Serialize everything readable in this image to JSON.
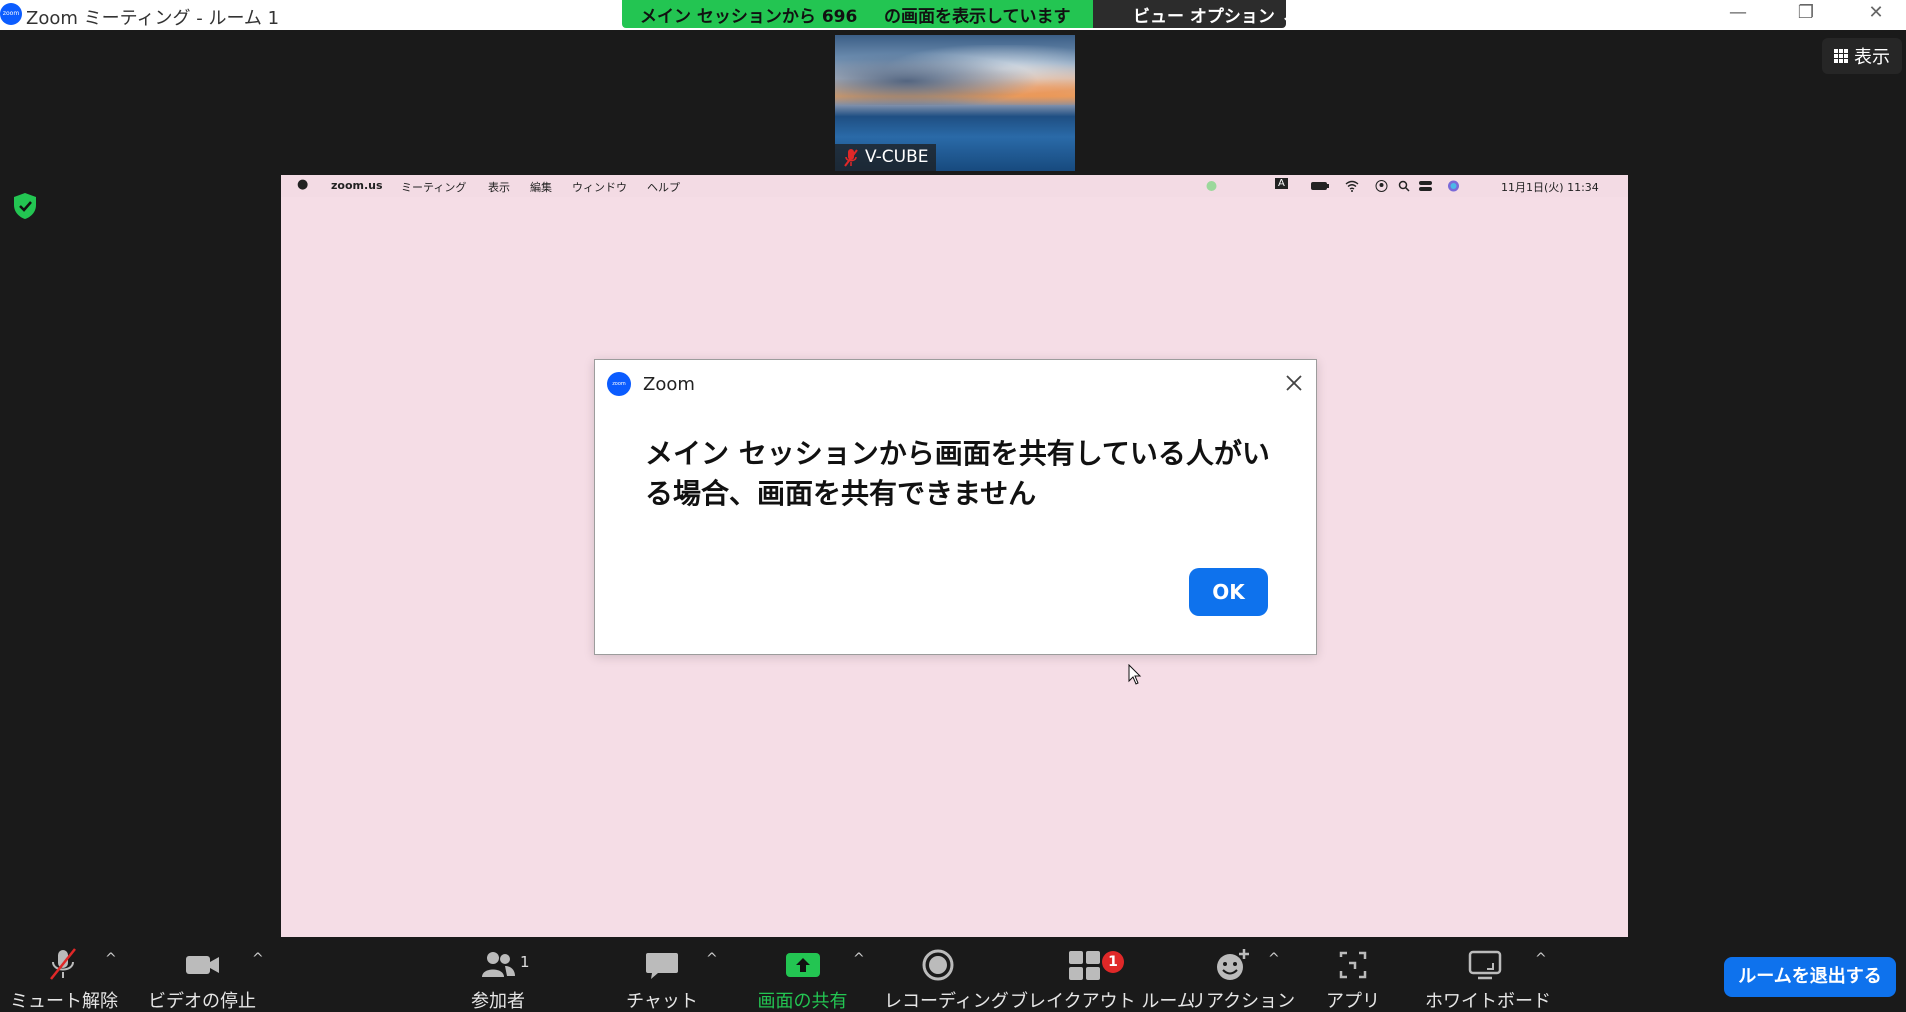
{
  "window": {
    "title": "Zoom ミーティング - ルーム 1",
    "app_logo_text": "zoom"
  },
  "banner": {
    "status_part1": "メイン セッションから 696",
    "status_part2": "の画面を表示しています",
    "view_options_label": "ビュー オプション ⌄"
  },
  "window_controls": {
    "minimize": "—",
    "restore": "❐",
    "close": "✕"
  },
  "view_button": {
    "label": "表示"
  },
  "participant": {
    "name": "V-CUBE"
  },
  "shared_screen": {
    "menubar": {
      "app": "zoom.us",
      "items": [
        "ミーティング",
        "表示",
        "編集",
        "ウィンドウ",
        "ヘルプ"
      ],
      "input_indicator": "A",
      "clock": "11月1日(火)  11:34"
    }
  },
  "dialog": {
    "title": "Zoom",
    "message": "メイン セッションから画面を共有している人がいる場合、画面を共有できません",
    "ok_label": "OK"
  },
  "toolbar": {
    "items": [
      {
        "label": "ミュート解除",
        "icon": "mic-muted-icon"
      },
      {
        "label": "ビデオの停止",
        "icon": "video-camera-icon"
      },
      {
        "label": "参加者",
        "icon": "participants-icon",
        "count": "1"
      },
      {
        "label": "チャット",
        "icon": "chat-icon"
      },
      {
        "label": "画面の共有",
        "icon": "share-screen-icon"
      },
      {
        "label": "レコーディング",
        "icon": "record-icon"
      },
      {
        "label": "ブレイクアウト ルーム",
        "icon": "breakout-rooms-icon",
        "badge": "1"
      },
      {
        "label": "リアクション",
        "icon": "reaction-icon"
      },
      {
        "label": "アプリ",
        "icon": "apps-icon"
      },
      {
        "label": "ホワイトボード",
        "icon": "whiteboard-icon"
      }
    ],
    "leave_label": "ルームを退出する"
  },
  "colors": {
    "share_green": "#23c552",
    "primary_blue": "#0e72ed",
    "shared_background": "#f5dde6",
    "muted_red": "#e02828"
  }
}
